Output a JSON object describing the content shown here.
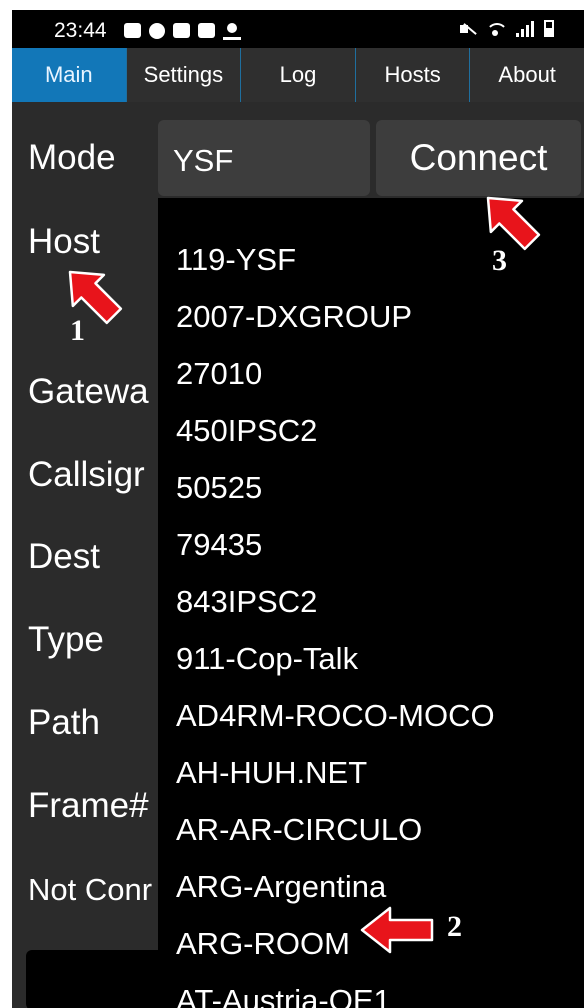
{
  "status_bar": {
    "time": "23:44",
    "icons": [
      "cc-icon",
      "facebook-icon",
      "gallery-icon",
      "youtube-icon",
      "weather-icon"
    ],
    "right_icons": [
      "mute-icon",
      "wifi-icon",
      "signal-icon",
      "battery-icon"
    ]
  },
  "tabs": [
    {
      "label": "Main",
      "active": true
    },
    {
      "label": "Settings",
      "active": false
    },
    {
      "label": "Log",
      "active": false
    },
    {
      "label": "Hosts",
      "active": false
    },
    {
      "label": "About",
      "active": false
    }
  ],
  "form": {
    "mode_label": "Mode",
    "mode_value": "YSF",
    "connect_label": "Connect",
    "host_label": "Host",
    "gateway_label": "Gatewa",
    "callsign_label": "Callsigr",
    "dest_label": "Dest",
    "type_label": "Type",
    "path_label": "Path",
    "frame_label": "Frame#",
    "status_label": "Not Conr"
  },
  "host_dropdown": {
    "items": [
      "119-YSF",
      "2007-DXGROUP",
      "27010",
      "450IPSC2",
      "50525",
      "79435",
      "843IPSC2",
      "911-Cop-Talk",
      "AD4RM-ROCO-MOCO",
      "AH-HUH.NET",
      "AR-AR-CIRCULO",
      "ARG-Argentina",
      "ARG-ROOM",
      "AT-Austria-OE1"
    ]
  },
  "annotations": {
    "marker_1": "1",
    "marker_2": "2",
    "marker_3": "3",
    "arrow_color": "#e8141b"
  },
  "colors": {
    "tab_active": "#1277b8",
    "background": "#2b2b2b",
    "input_bg": "#3d3d3d",
    "dropdown_bg": "#000000"
  }
}
